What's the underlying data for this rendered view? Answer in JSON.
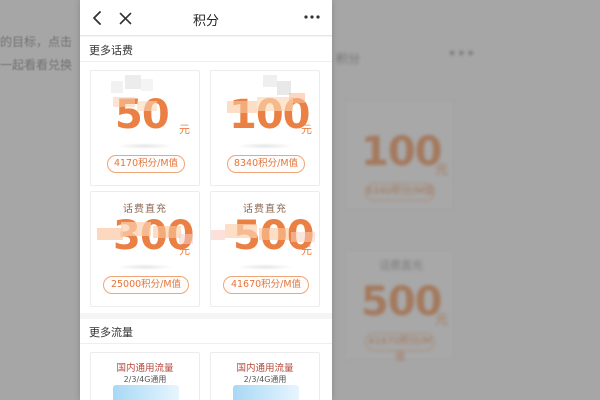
{
  "background": {
    "left_text_1": "的目标，点击",
    "left_text_2": "一起看看兑换",
    "right_title": "积分",
    "right_more": "•••",
    "cards": [
      {
        "label": "",
        "amount": "100",
        "unit": "元",
        "points": "8340积分/M值"
      },
      {
        "label": "话费直充",
        "amount": "500",
        "unit": "元",
        "points": "41670积分/M值"
      }
    ]
  },
  "nav": {
    "title": "积分",
    "back_icon": "chevron-left-icon",
    "close_icon": "close-icon",
    "more_icon": "more-dots-icon"
  },
  "section_phone": {
    "title": "更多话费",
    "cards": [
      {
        "label": "",
        "amount": "50",
        "unit": "元",
        "points": "4170积分/M值"
      },
      {
        "label": "",
        "amount": "100",
        "unit": "元",
        "points": "8340积分/M值"
      },
      {
        "label": "话费直充",
        "amount": "300",
        "unit": "元",
        "points": "25000积分/M值"
      },
      {
        "label": "话费直充",
        "amount": "500",
        "unit": "元",
        "points": "41670积分/M值"
      }
    ]
  },
  "section_data": {
    "title": "更多流量",
    "cards": [
      {
        "title": "国内通用流量",
        "subtitle": "2/3/4G通用"
      },
      {
        "title": "国内通用流量",
        "subtitle": "2/3/4G通用"
      }
    ]
  },
  "colors": {
    "accent": "#ea8043",
    "pill_border": "#f0a577",
    "traffic_title": "#b4473a",
    "overlay": "rgba(60,60,60,0.42)"
  }
}
